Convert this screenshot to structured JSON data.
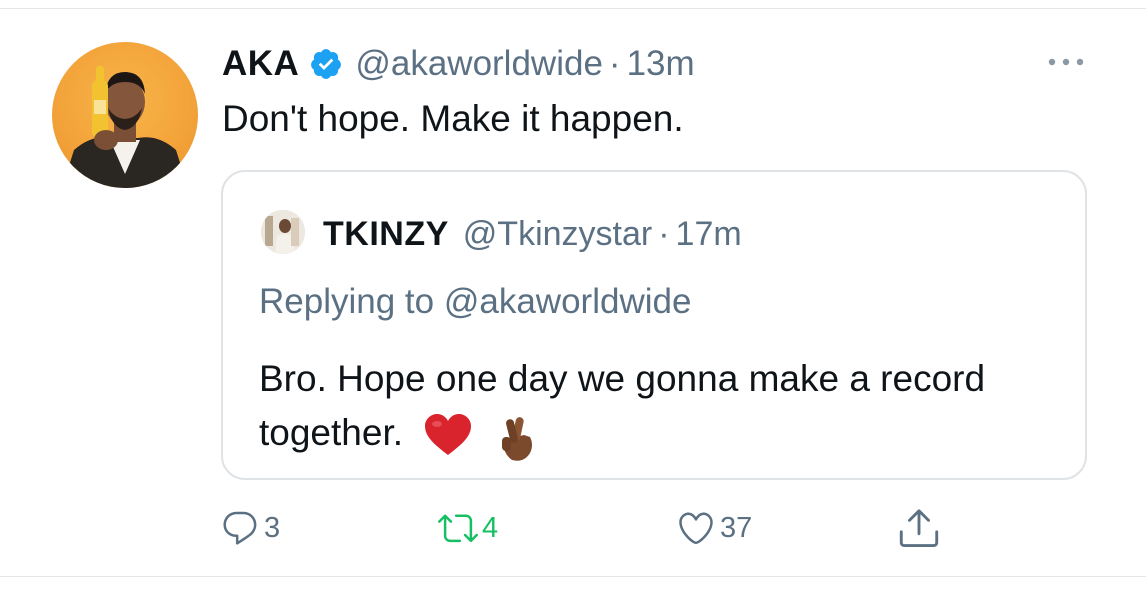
{
  "tweet": {
    "display_name": "AKA",
    "handle": "@akaworldwide",
    "separator": "·",
    "time": "13m",
    "text": "Don't hope. Make it happen.",
    "verified": true
  },
  "quoted_tweet": {
    "display_name": "TKINZY",
    "handle": "@Tkinzystar",
    "separator": "·",
    "time": "17m",
    "replying_label": "Replying to",
    "replying_to": "@akaworldwide",
    "text": "Bro. Hope one day we gonna make a record together.",
    "emojis": [
      "heart-emoji",
      "crossed-fingers-emoji"
    ]
  },
  "actions": {
    "reply_count": "3",
    "retweet_count": "4",
    "like_count": "37"
  },
  "icons": {
    "verified": "verified-badge-icon",
    "more": "more-icon",
    "reply": "reply-icon",
    "retweet": "retweet-icon",
    "like": "heart-icon",
    "share": "share-icon"
  },
  "colors": {
    "verified_blue": "#1da1f2",
    "secondary_text": "#5b7083",
    "retweet_green": "#17bf63",
    "primary_text": "#0f1419",
    "border": "#dfe3e6"
  }
}
